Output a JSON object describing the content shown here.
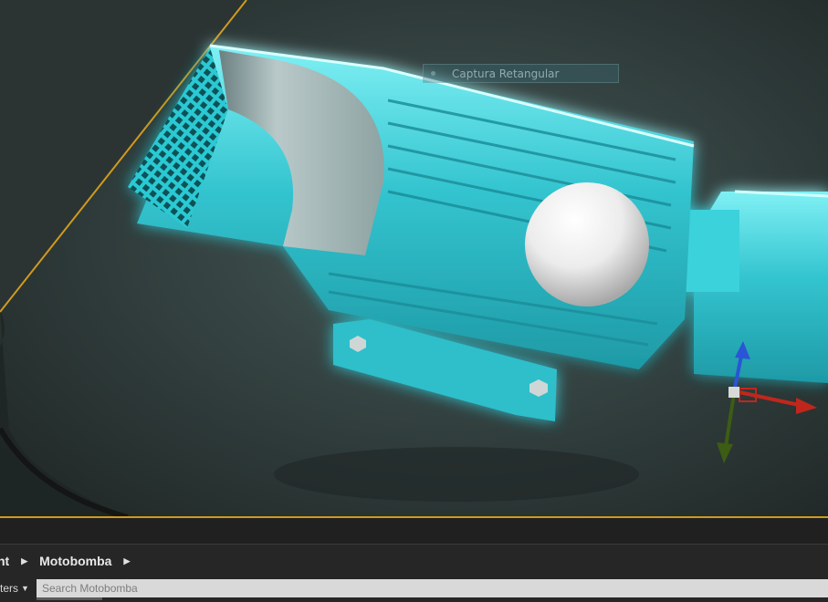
{
  "viewport": {
    "tooltip_text": "Captura Retangular",
    "highlight_color": "#2fd8e0",
    "selection_color": "#d09a1e",
    "gizmo_colors": {
      "x": "#c0271c",
      "y": "#3d5c14",
      "z": "#2a55d6"
    }
  },
  "content_browser": {
    "breadcrumb": [
      {
        "label": "nt"
      },
      {
        "label": "Motobomba"
      }
    ],
    "filters_label": "ters",
    "search_placeholder": "Search Motobomba"
  }
}
